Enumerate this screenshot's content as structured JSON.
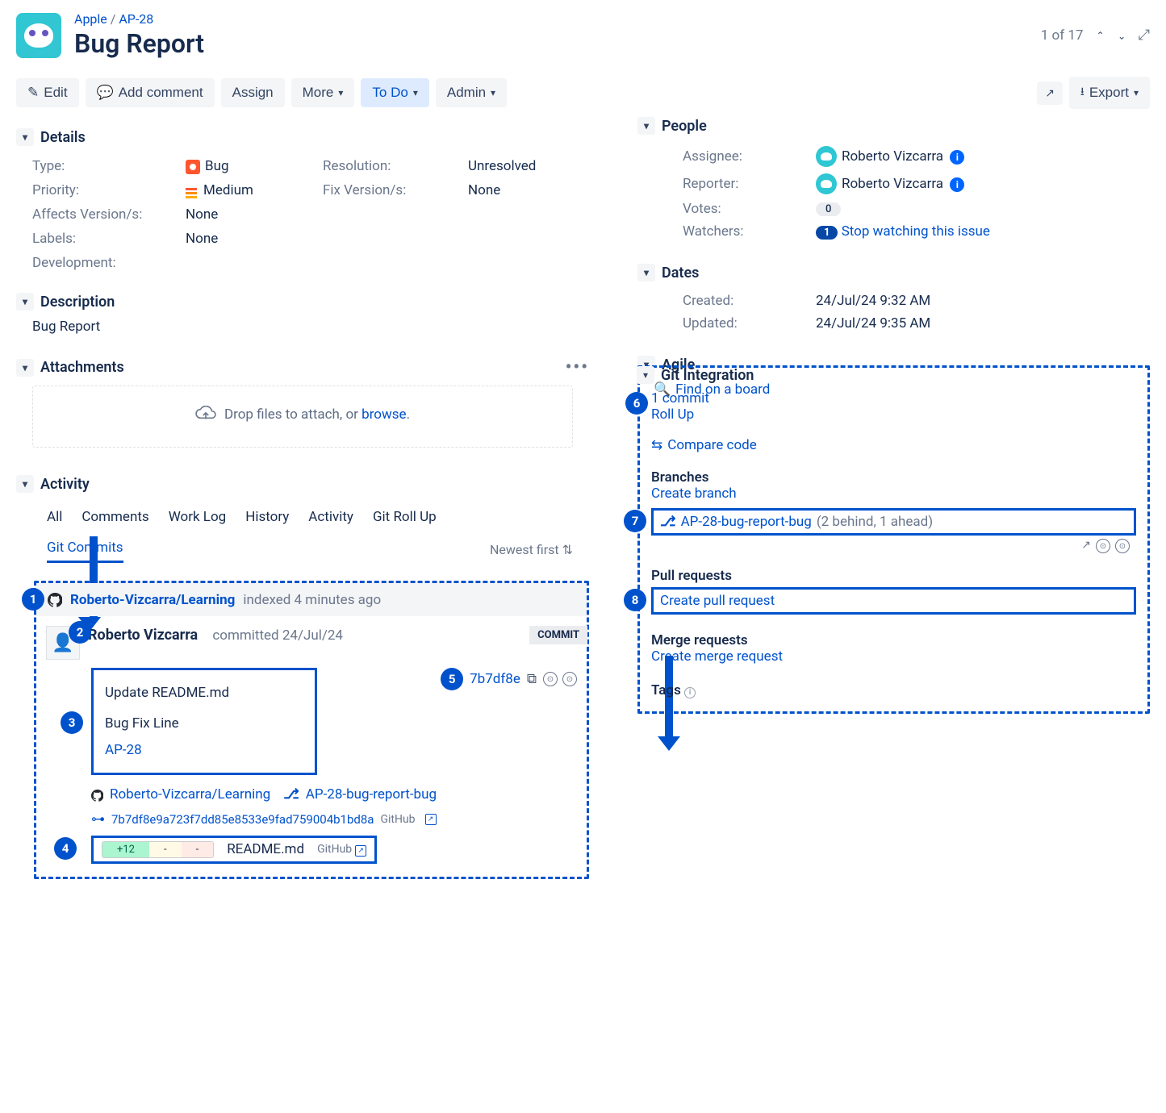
{
  "breadcrumb": {
    "project": "Apple",
    "key": "AP-28"
  },
  "title": "Bug Report",
  "pager": {
    "label": "1 of 17"
  },
  "toolbar": {
    "edit": "Edit",
    "add_comment": "Add comment",
    "assign": "Assign",
    "more": "More",
    "status": "To Do",
    "admin": "Admin",
    "export": "Export"
  },
  "details": {
    "heading": "Details",
    "type_lbl": "Type:",
    "type_val": "Bug",
    "priority_lbl": "Priority:",
    "priority_val": "Medium",
    "affects_lbl": "Affects Version/s:",
    "affects_val": "None",
    "labels_lbl": "Labels:",
    "labels_val": "None",
    "dev_lbl": "Development:",
    "resolution_lbl": "Resolution:",
    "resolution_val": "Unresolved",
    "fixver_lbl": "Fix Version/s:",
    "fixver_val": "None"
  },
  "description": {
    "heading": "Description",
    "text": "Bug Report"
  },
  "attachments": {
    "heading": "Attachments",
    "drop_prefix": "Drop files to attach, or ",
    "browse": "browse",
    "drop_suffix": "."
  },
  "activity": {
    "heading": "Activity",
    "tabs": {
      "all": "All",
      "comments": "Comments",
      "worklog": "Work Log",
      "history": "History",
      "activity": "Activity",
      "gitrollup": "Git Roll Up",
      "gitcommits": "Git Commits"
    },
    "sort": "Newest first"
  },
  "callouts": {
    "1": "1",
    "2": "2",
    "3": "3",
    "4": "4",
    "5": "5",
    "6": "6",
    "7": "7",
    "8": "8"
  },
  "repo": {
    "name": "Roberto-Vizcarra/Learning",
    "indexed": "indexed 4 minutes ago",
    "author": "Roberto Vizcarra",
    "committed_lbl": "committed 24/Jul/24",
    "badge": "COMMIT",
    "msg_line1": "Update README.md",
    "msg_line2": "Bug Fix Line",
    "msg_key": "AP-28",
    "hash_short": "7b7df8e",
    "hash_long_prefix": "7b7df8e9a723f7dd85e8533e9fad759004b1bd8a",
    "source_label": "GitHub",
    "branch": "AP-28-bug-report-bug",
    "diff_add": "+12",
    "diff_sub": "-",
    "diff_del": "-",
    "file": "README.md"
  },
  "people": {
    "heading": "People",
    "assignee_lbl": "Assignee:",
    "assignee": "Roberto Vizcarra",
    "reporter_lbl": "Reporter:",
    "reporter": "Roberto Vizcarra",
    "votes_lbl": "Votes:",
    "votes": "0",
    "watchers_lbl": "Watchers:",
    "watchers_count": "1",
    "stop_watch": "Stop watching this issue"
  },
  "dates": {
    "heading": "Dates",
    "created_lbl": "Created:",
    "created": "24/Jul/24 9:32 AM",
    "updated_lbl": "Updated:",
    "updated": "24/Jul/24 9:35 AM"
  },
  "agile": {
    "heading": "Agile",
    "find": "Find on a board"
  },
  "git": {
    "heading": "Git Integration",
    "commits_link": "1 commit",
    "rollup": "Roll Up",
    "compare": "Compare code",
    "branches_h": "Branches",
    "create_branch": "Create branch",
    "branch_name": "AP-28-bug-report-bug",
    "branch_stat": "(2 behind, 1 ahead)",
    "pr_h": "Pull requests",
    "create_pr": "Create pull request",
    "mr_h": "Merge requests",
    "create_mr": "Create merge request",
    "tags": "Tags"
  }
}
